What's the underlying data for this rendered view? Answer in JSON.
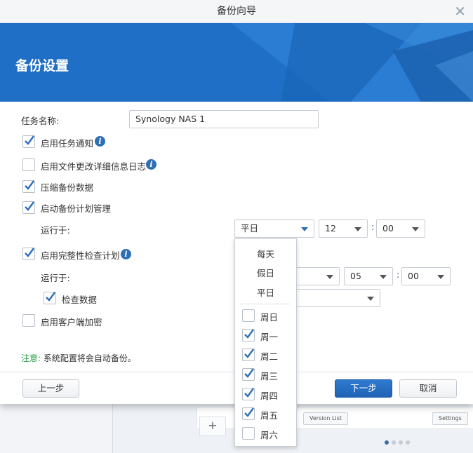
{
  "dialog": {
    "title": "备份向导",
    "banner_title": "备份设置"
  },
  "form": {
    "task_name_label": "任务名称:",
    "task_name_value": "Synology NAS 1",
    "enable_notification": {
      "label": "启用任务通知",
      "checked": true
    },
    "enable_file_log": {
      "label": "启用文件更改详细信息日志",
      "checked": false
    },
    "compress": {
      "label": "压缩备份数据",
      "checked": true
    },
    "schedule": {
      "label": "启动备份计划管理",
      "checked": true
    },
    "schedule_run_label": "运行于:",
    "schedule_day": "平日",
    "schedule_hour": "12",
    "schedule_minute": "00",
    "integrity": {
      "label": "启用完整性检查计划",
      "checked": true
    },
    "integrity_run_label": "运行于:",
    "integrity_hour": "05",
    "integrity_minute": "00",
    "check_data": {
      "label": "检查数据",
      "checked": true
    },
    "client_encrypt": {
      "label": "启用客户端加密",
      "checked": false
    },
    "colon": ":"
  },
  "note": {
    "prefix": "注意:",
    "text": " 系统配置将会自动备份。"
  },
  "footer": {
    "back_label": "上一步",
    "next_label": "下一步",
    "cancel_label": "取消"
  },
  "dropdown": {
    "presets": [
      "每天",
      "假日",
      "平日"
    ],
    "days": [
      {
        "label": "周日",
        "checked": false
      },
      {
        "label": "周一",
        "checked": true
      },
      {
        "label": "周二",
        "checked": true
      },
      {
        "label": "周三",
        "checked": true
      },
      {
        "label": "周四",
        "checked": true
      },
      {
        "label": "周五",
        "checked": true
      },
      {
        "label": "周六",
        "checked": false
      }
    ]
  },
  "background": {
    "version_list": "Version List",
    "settings": "Settings",
    "plus": "+"
  },
  "colors": {
    "accent": "#2e6fb5",
    "banner": "#1f6fc6",
    "note_highlight": "#2f9e4a"
  }
}
